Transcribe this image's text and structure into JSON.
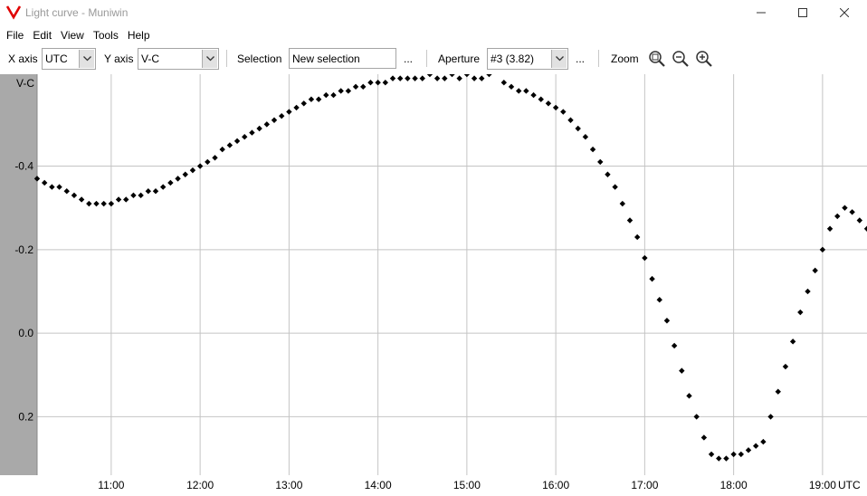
{
  "window": {
    "title": "Light curve - Muniwin",
    "accent": "#e00000"
  },
  "menu": [
    "File",
    "Edit",
    "View",
    "Tools",
    "Help"
  ],
  "toolbar": {
    "x_axis_label": "X axis",
    "x_axis_value": "UTC",
    "y_axis_label": "Y axis",
    "y_axis_value": "V-C",
    "selection_label": "Selection",
    "selection_value": "New selection",
    "selection_more": "...",
    "aperture_label": "Aperture",
    "aperture_value": "#3 (3.82)",
    "aperture_more": "...",
    "zoom_label": "Zoom",
    "zoom_icons": [
      "zoom-fit-icon",
      "zoom-out-icon",
      "zoom-in-icon"
    ]
  },
  "chart_data": {
    "type": "scatter",
    "xlabel": "UTC",
    "ylabel": "V-C",
    "y_inverted": true,
    "grid": true,
    "xlim": [
      "10:10",
      "19:30"
    ],
    "ylim": [
      -0.62,
      0.34
    ],
    "x_ticks": [
      "11:00",
      "12:00",
      "13:00",
      "14:00",
      "15:00",
      "16:00",
      "17:00",
      "18:00",
      "19:00"
    ],
    "y_ticks": [
      "-0.4",
      "-0.2",
      "0.0",
      "0.2"
    ],
    "marker": "diamond",
    "marker_color": "#000000",
    "series": [
      {
        "x": [
          "10:10",
          "10:15",
          "10:20",
          "10:25",
          "10:30",
          "10:35",
          "10:40",
          "10:45",
          "10:50",
          "10:55",
          "11:00",
          "11:05",
          "11:10",
          "11:15",
          "11:20",
          "11:25",
          "11:30",
          "11:35",
          "11:40",
          "11:45",
          "11:50",
          "11:55",
          "12:00",
          "12:05",
          "12:10",
          "12:15",
          "12:20",
          "12:25",
          "12:30",
          "12:35",
          "12:40",
          "12:45",
          "12:50",
          "12:55",
          "13:00",
          "13:05",
          "13:10",
          "13:15",
          "13:20",
          "13:25",
          "13:30",
          "13:35",
          "13:40",
          "13:45",
          "13:50",
          "13:55",
          "14:00",
          "14:05",
          "14:10",
          "14:15",
          "14:20",
          "14:25",
          "14:30",
          "14:35",
          "14:40",
          "14:45",
          "14:50",
          "14:55",
          "15:00",
          "15:05",
          "15:10",
          "15:15",
          "15:25",
          "15:30",
          "15:35",
          "15:40",
          "15:45",
          "15:50",
          "15:55",
          "16:00",
          "16:05",
          "16:10",
          "16:15",
          "16:20",
          "16:25",
          "16:30",
          "16:35",
          "16:40",
          "16:45",
          "16:50",
          "16:55",
          "17:00",
          "17:05",
          "17:10",
          "17:15",
          "17:20",
          "17:25",
          "17:30",
          "17:35",
          "17:40",
          "17:45",
          "17:50",
          "17:55",
          "18:00",
          "18:05",
          "18:10",
          "18:15",
          "18:20",
          "18:25",
          "18:30",
          "18:35",
          "18:40",
          "18:45",
          "18:50",
          "18:55",
          "19:00",
          "19:05",
          "19:10",
          "19:15",
          "19:20",
          "19:25",
          "19:30"
        ],
        "y": [
          -0.37,
          -0.36,
          -0.35,
          -0.35,
          -0.34,
          -0.33,
          -0.32,
          -0.31,
          -0.31,
          -0.31,
          -0.31,
          -0.32,
          -0.32,
          -0.33,
          -0.33,
          -0.34,
          -0.34,
          -0.35,
          -0.36,
          -0.37,
          -0.38,
          -0.39,
          -0.4,
          -0.41,
          -0.42,
          -0.44,
          -0.45,
          -0.46,
          -0.47,
          -0.48,
          -0.49,
          -0.5,
          -0.51,
          -0.52,
          -0.53,
          -0.54,
          -0.55,
          -0.56,
          -0.56,
          -0.57,
          -0.57,
          -0.58,
          -0.58,
          -0.59,
          -0.59,
          -0.6,
          -0.6,
          -0.6,
          -0.61,
          -0.61,
          -0.61,
          -0.61,
          -0.61,
          -0.62,
          -0.61,
          -0.61,
          -0.62,
          -0.61,
          -0.62,
          -0.61,
          -0.61,
          -0.62,
          -0.6,
          -0.59,
          -0.58,
          -0.58,
          -0.57,
          -0.56,
          -0.55,
          -0.54,
          -0.53,
          -0.51,
          -0.49,
          -0.47,
          -0.44,
          -0.41,
          -0.38,
          -0.35,
          -0.31,
          -0.27,
          -0.23,
          -0.18,
          -0.13,
          -0.08,
          -0.03,
          0.03,
          0.09,
          0.15,
          0.2,
          0.25,
          0.29,
          0.3,
          0.3,
          0.29,
          0.29,
          0.28,
          0.27,
          0.26,
          0.2,
          0.14,
          0.08,
          0.02,
          -0.05,
          -0.1,
          -0.15,
          -0.2,
          -0.25,
          -0.28,
          -0.3,
          -0.29,
          -0.27,
          -0.25
        ]
      }
    ]
  }
}
